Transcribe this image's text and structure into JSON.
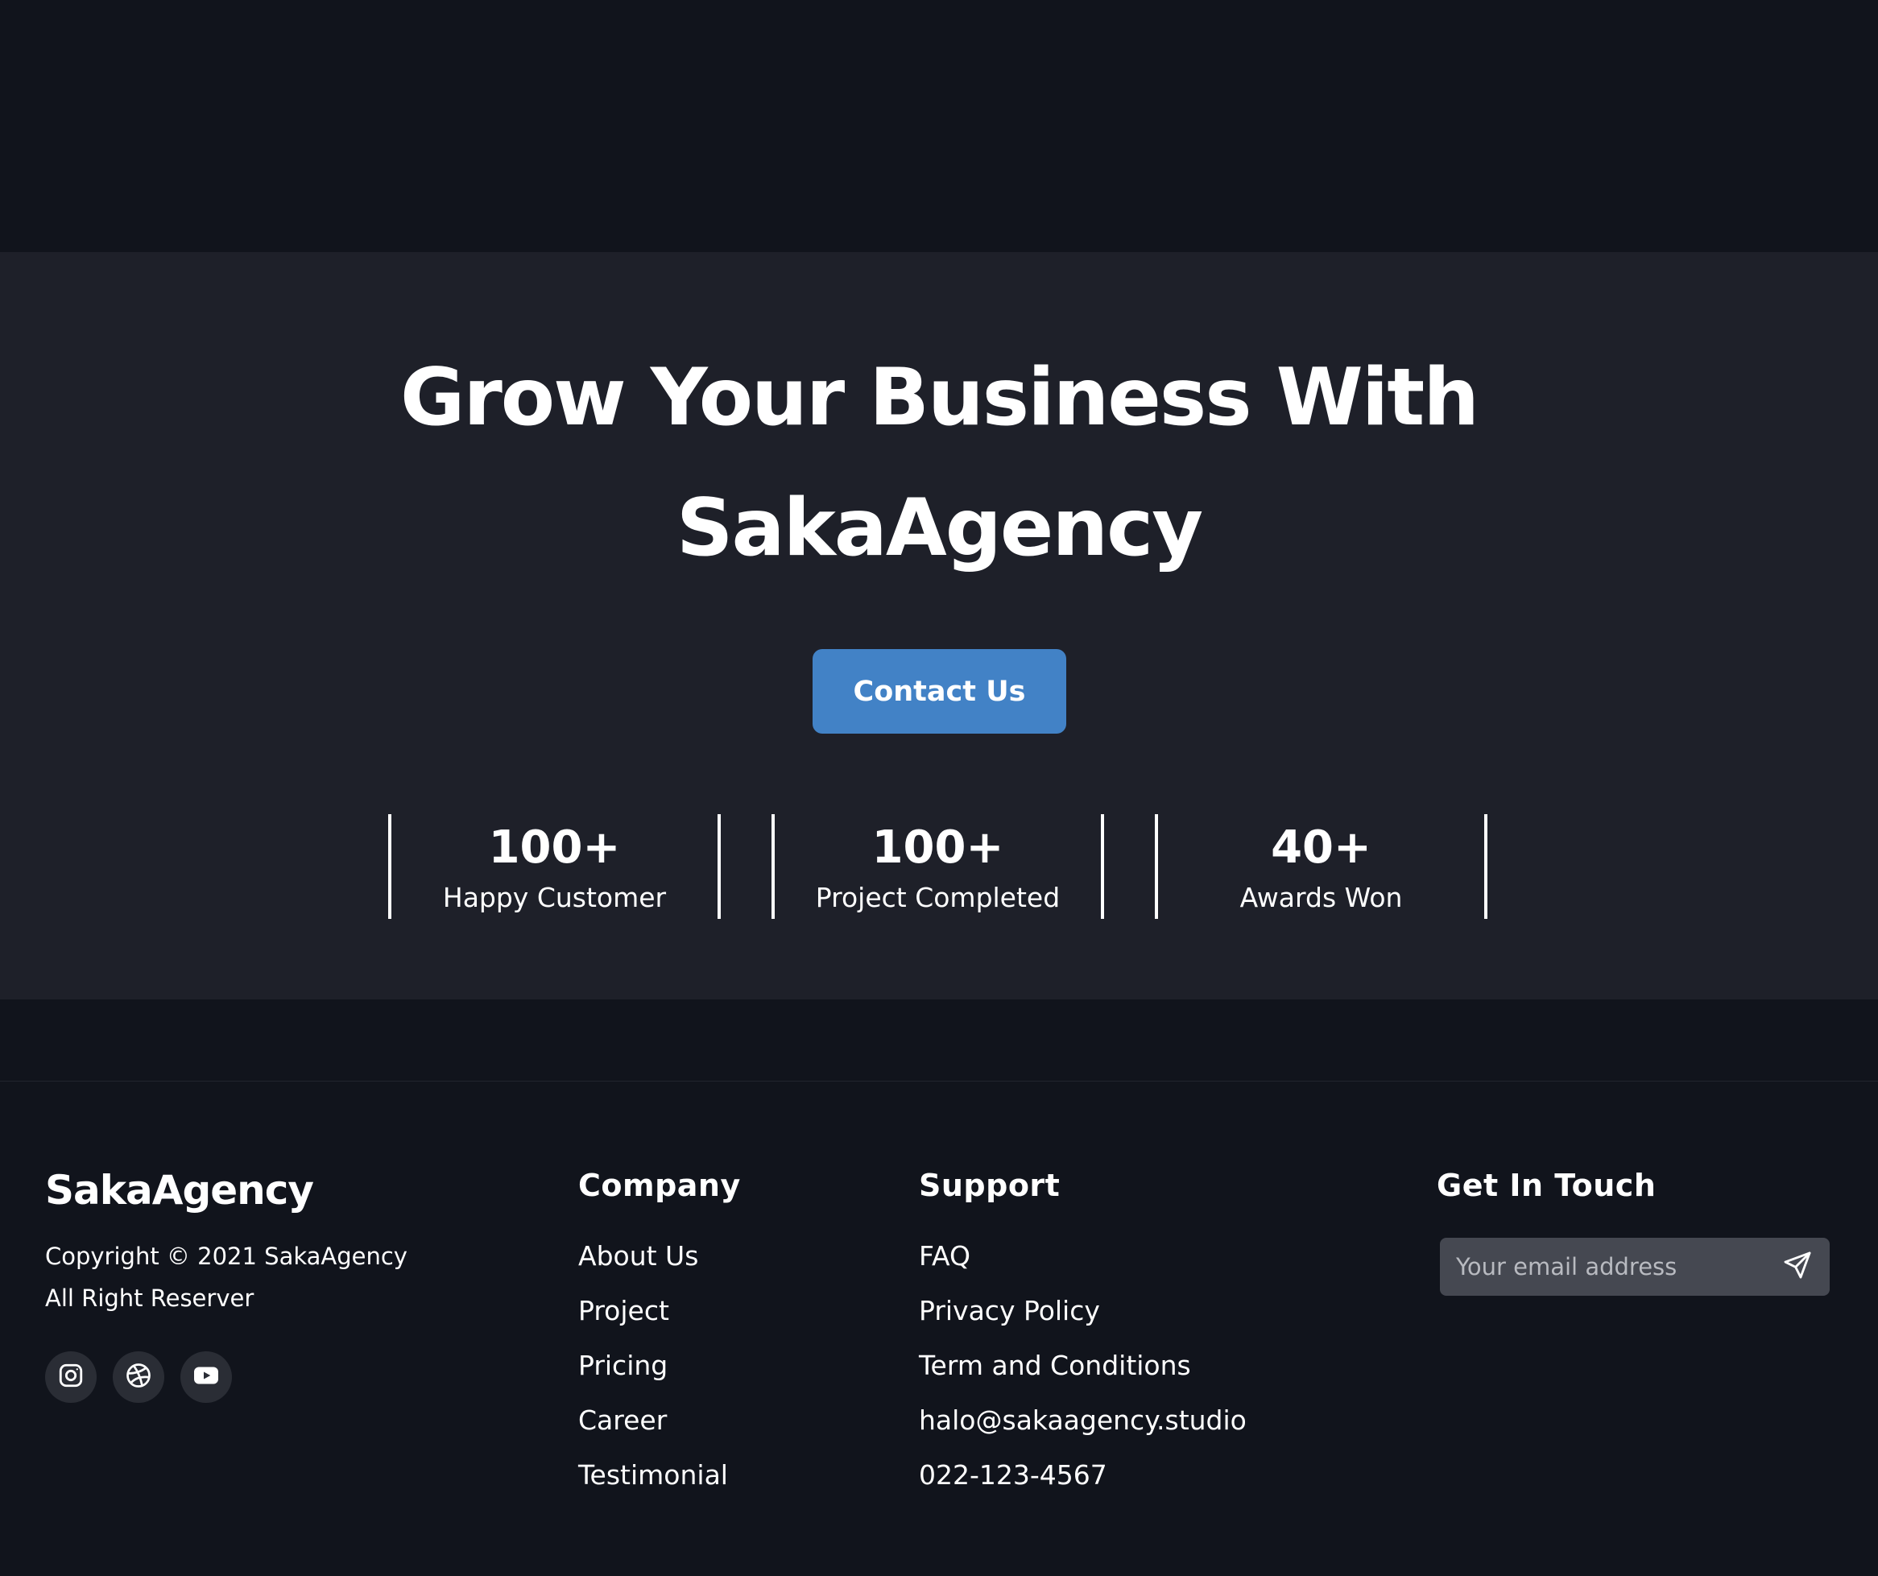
{
  "cta": {
    "title_line1": "Grow Your Business With",
    "title_line2": "SakaAgency",
    "button_label": "Contact Us",
    "button_color": "#4282c6"
  },
  "stats": [
    {
      "value": "100+",
      "label": "Happy Customer"
    },
    {
      "value": "100+",
      "label": "Project Completed"
    },
    {
      "value": "40+",
      "label": "Awards Won"
    }
  ],
  "footer": {
    "logo": "SakaAgency",
    "copyright_line1": "Copyright © 2021 SakaAgency",
    "copyright_line2": "All Right Reserver",
    "social_icons": [
      "instagram-icon",
      "dribbble-icon",
      "youtube-icon"
    ],
    "company": {
      "heading": "Company",
      "links": [
        "About Us",
        "Project",
        "Pricing",
        "Career",
        "Testimonial"
      ]
    },
    "support": {
      "heading": "Support",
      "links": [
        "FAQ",
        "Privacy Policy",
        "Term and Conditions",
        "halo@sakaagency.studio",
        "022-123-4567"
      ]
    },
    "contact": {
      "heading": "Get In Touch",
      "email_placeholder": "Your email address",
      "send_icon": "send-icon"
    }
  },
  "colors": {
    "page_bg": "#11141c",
    "cta_bg": "#1e2029",
    "input_bg": "#454851",
    "social_bg": "#2a2d35"
  }
}
